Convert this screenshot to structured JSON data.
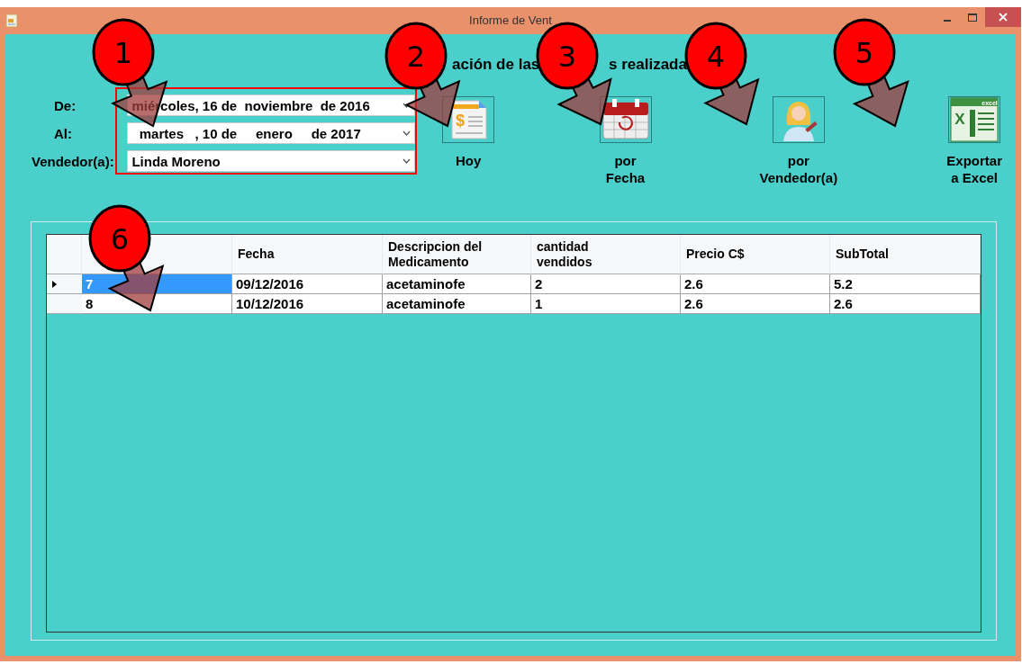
{
  "window": {
    "title": "Informe de Vent"
  },
  "heading_fragments": [
    "ación de las",
    "s realizada"
  ],
  "filters": [
    {
      "kind": "date",
      "label": "De:",
      "value": "miércoles, 16 de  noviembre  de 2016"
    },
    {
      "kind": "date",
      "label": "Al:",
      "value": "  martes   , 10 de     enero     de 2017"
    },
    {
      "kind": "select",
      "label": "Vendedor(a):",
      "value": "Linda Moreno"
    }
  ],
  "buttons": [
    {
      "kind": "today",
      "lines": [
        "Hoy"
      ],
      "icon_glyph": "$"
    },
    {
      "kind": "date",
      "lines": [
        "por",
        "Fecha"
      ]
    },
    {
      "kind": "seller",
      "lines": [
        "por",
        "Vendedor(a)"
      ]
    },
    {
      "kind": "excel",
      "lines": [
        "Exportar",
        "a Excel"
      ],
      "icon_caption": "excel",
      "icon_letter": "X"
    }
  ],
  "table": {
    "columns": [
      "",
      "Fecha",
      "Descripcion del\nMedicamento",
      "cantidad\nvendidos",
      "Precio C$",
      "SubTotal"
    ],
    "rows": [
      {
        "current": true,
        "selected": true,
        "cells": [
          "7",
          "09/12/2016",
          "acetaminofe",
          "2",
          "2.6",
          "5.2"
        ]
      },
      {
        "current": false,
        "selected": false,
        "cells": [
          "8",
          "10/12/2016",
          "acetaminofe",
          "1",
          "2.6",
          "2.6"
        ]
      }
    ]
  },
  "callouts": [
    "1",
    "2",
    "3",
    "4",
    "5",
    "6"
  ]
}
